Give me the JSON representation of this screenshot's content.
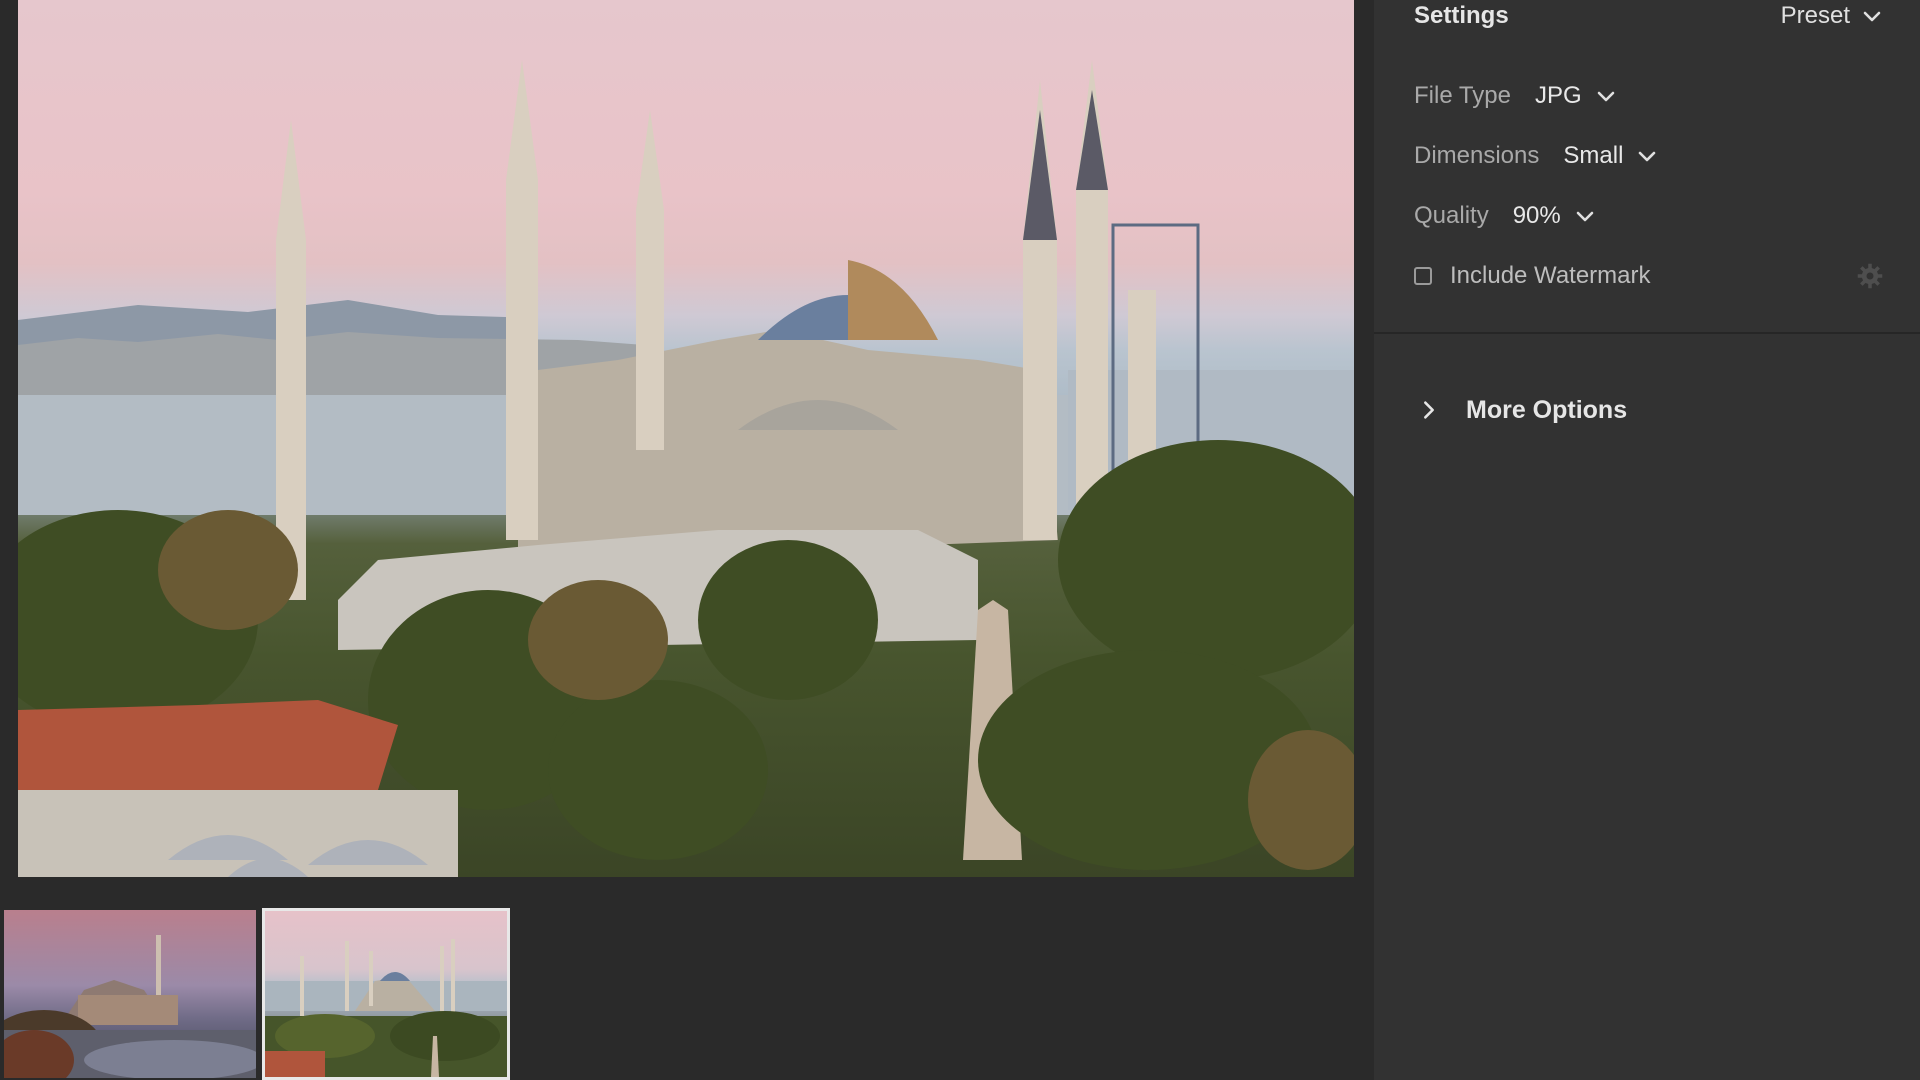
{
  "settings": {
    "title": "Settings",
    "preset_label": "Preset",
    "file_type": {
      "label": "File Type",
      "value": "JPG"
    },
    "dimensions": {
      "label": "Dimensions",
      "value": "Small"
    },
    "quality": {
      "label": "Quality",
      "value": "90%"
    },
    "watermark": {
      "label": "Include Watermark",
      "checked": false
    },
    "more_options_label": "More Options"
  },
  "filmstrip": {
    "selected_index": 1,
    "count": 2
  },
  "icons": {
    "preset": "chevron-down-icon",
    "file_type": "chevron-down-icon",
    "dimensions": "chevron-down-icon",
    "quality": "chevron-down-icon",
    "watermark_settings": "gear-icon",
    "more_options": "chevron-right-icon"
  },
  "colors": {
    "panel_bg": "#323232",
    "app_bg": "#2a2a2a",
    "selected_thumb_border": "#e8e8e8"
  }
}
